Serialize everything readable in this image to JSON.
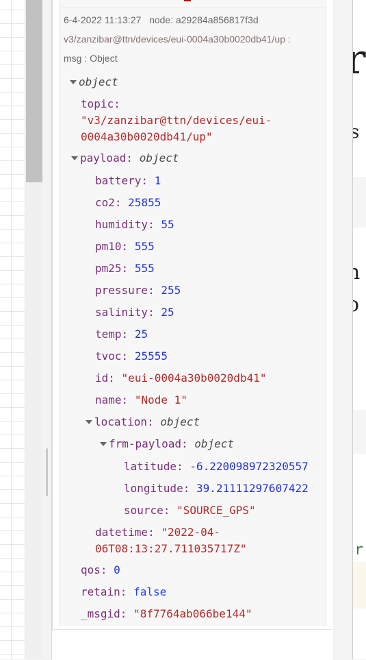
{
  "message": {
    "timestamp": "6-4-2022 11:13:27",
    "node_label": "node: a29284a856817f3d",
    "topic_path": "v3/zanzibar@ttn/devices/eui-0004a30b0020db41/up :",
    "msg_label": "msg : Object"
  },
  "tree": {
    "root_type": "object",
    "topic_key": "topic:",
    "topic_line1": "\"v3/zanzibar@ttn/devices/eui-",
    "topic_line2": "0004a30b0020db41/up\"",
    "payload_key": "payload:",
    "payload_type": "object",
    "battery_key": "battery:",
    "battery": "1",
    "co2_key": "co2:",
    "co2": "25855",
    "humidity_key": "humidity:",
    "humidity": "55",
    "pm10_key": "pm10:",
    "pm10": "555",
    "pm25_key": "pm25:",
    "pm25": "555",
    "pressure_key": "pressure:",
    "pressure": "255",
    "salinity_key": "salinity:",
    "salinity": "25",
    "temp_key": "temp:",
    "temp": "25",
    "tvoc_key": "tvoc:",
    "tvoc": "25555",
    "id_key": "id:",
    "id": "\"eui-0004a30b0020db41\"",
    "name_key": "name:",
    "name": "\"Node 1\"",
    "location_key": "location:",
    "location_type": "object",
    "frm_key": "frm-payload:",
    "frm_type": "object",
    "latitude_key": "latitude:",
    "latitude": "-6.220098972320557",
    "longitude_key": "longitude:",
    "longitude": "39.21111297607422",
    "source_key": "source:",
    "source": "\"SOURCE_GPS\"",
    "datetime_key": "datetime:",
    "datetime_line1": "\"2022-04-",
    "datetime_line2": "06T08:13:27.711035717Z\"",
    "qos_key": "qos:",
    "qos": "0",
    "retain_key": "retain:",
    "retain": "false",
    "msgid_key": "_msgid:",
    "msgid": "\"8f7764ab066be144\""
  },
  "editor": {
    "c1": "r",
    "c2": "s",
    "c3": "n",
    "c4": "o",
    "c5": "r"
  },
  "colors": {
    "key": "#792e79",
    "number": "#2033d6",
    "string": "#b72828",
    "boolean": "#1c48ff"
  }
}
